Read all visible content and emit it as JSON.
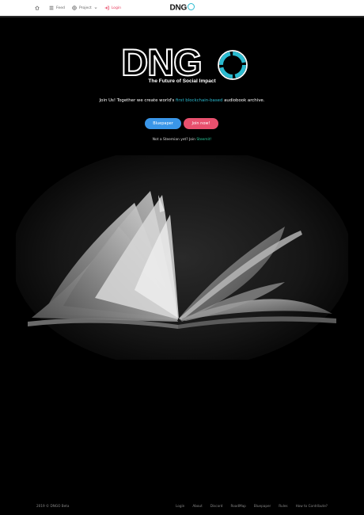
{
  "topbar": {
    "nav": [
      {
        "label": "",
        "icon": "home-icon"
      },
      {
        "label": "Feed",
        "icon": "list-icon"
      },
      {
        "label": "Project",
        "icon": "globe-icon",
        "dropdown": true
      },
      {
        "label": "Login",
        "icon": "sign-in-icon"
      }
    ],
    "brand": "DNG"
  },
  "hero": {
    "logo": "DNG",
    "tagline": "The Future of Social Impact",
    "intro_before": "Join Us! Together we create world's ",
    "intro_highlight": "first blockchain-based",
    "intro_after": " audiobook archive.",
    "btn_primary": "Bluepaper",
    "btn_secondary": "Join now!",
    "steem_prefix": "Not a Steemian yet? Join ",
    "steem_link": "Steemit!"
  },
  "footer": {
    "copyright": "2019 © DNGO Beta",
    "links": [
      "Login",
      "About",
      "Discord",
      "RoadMap",
      "Bluepaper",
      "Rules",
      "How to Contribute?"
    ]
  },
  "colors": {
    "accent_cyan": "#2bbbd0",
    "primary_button": "#3a96e8",
    "secondary_button": "#e8506e",
    "link_green": "#2bd0a0",
    "login_pink": "#e83a5c"
  }
}
